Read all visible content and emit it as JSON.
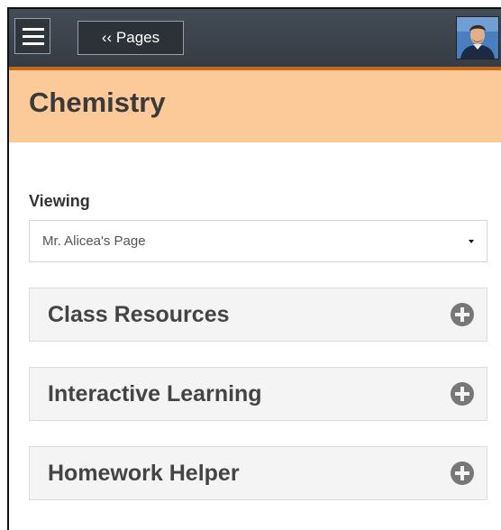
{
  "header": {
    "pages_button_label": "‹‹ Pages"
  },
  "title_band": {
    "title": "Chemistry"
  },
  "viewing": {
    "label": "Viewing",
    "selected_value": "Mr. Alicea's Page"
  },
  "panels": [
    {
      "title": "Class Resources"
    },
    {
      "title": "Interactive Learning"
    },
    {
      "title": "Homework Helper"
    }
  ],
  "colors": {
    "topbar": "#3c434b",
    "topbar_accent": "#c36a1a",
    "title_band": "#fcca99",
    "panel_background": "#f4f4f4",
    "plus_icon": "#777777"
  },
  "icons": {
    "menu": "hamburger-icon",
    "panel_expand": "plus-circle-icon",
    "select_caret": "caret-down-icon"
  }
}
